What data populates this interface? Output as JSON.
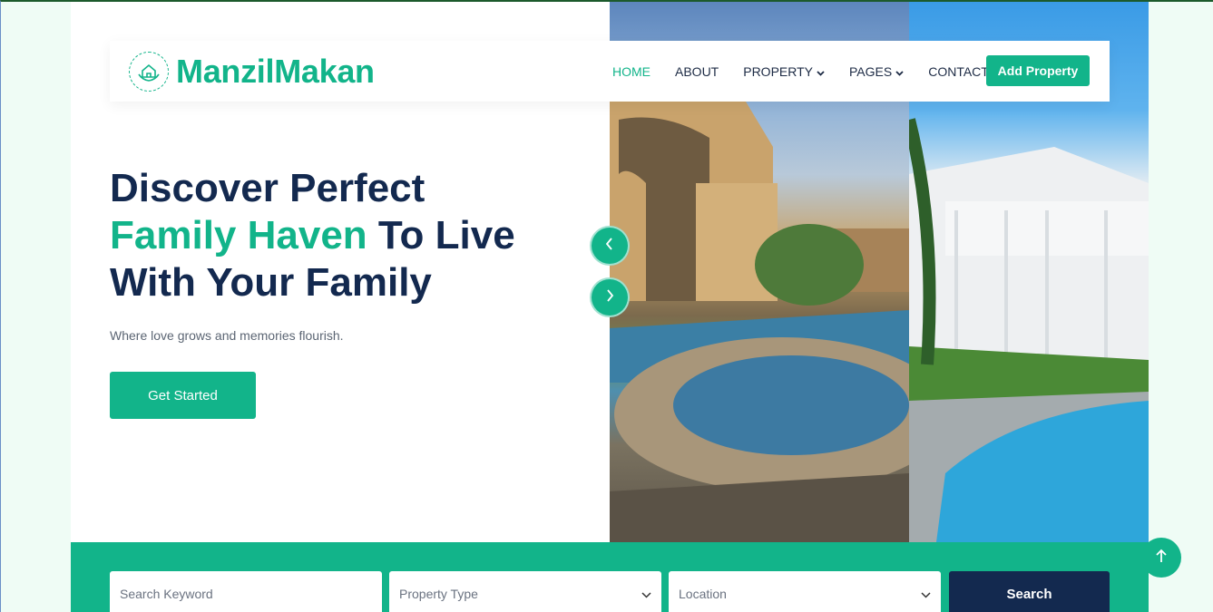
{
  "brand": {
    "name": "ManzilMakan",
    "logo_icon": "house-hands-icon"
  },
  "nav": {
    "items": [
      {
        "label": "HOME",
        "active": true,
        "dropdown": false
      },
      {
        "label": "ABOUT",
        "active": false,
        "dropdown": false
      },
      {
        "label": "PROPERTY",
        "active": false,
        "dropdown": true
      },
      {
        "label": "PAGES",
        "active": false,
        "dropdown": true
      },
      {
        "label": "CONTACT",
        "active": false,
        "dropdown": false
      }
    ],
    "cta_label": "Add Property"
  },
  "hero": {
    "line1": "Discover Perfect",
    "line2_accent": "Family Haven",
    "line2_rest": " To Live",
    "line3": "With Your Family",
    "subtitle": "Where love grows and memories flourish.",
    "button_label": "Get Started",
    "prev_icon": "chevron-left-icon",
    "next_icon": "chevron-right-icon"
  },
  "search": {
    "keyword_placeholder": "Search Keyword",
    "property_type": "Property Type",
    "location": "Location",
    "button_label": "Search"
  },
  "colors": {
    "accent": "#12b48a",
    "navy": "#13294f"
  },
  "scroll_top_icon": "arrow-up-icon"
}
